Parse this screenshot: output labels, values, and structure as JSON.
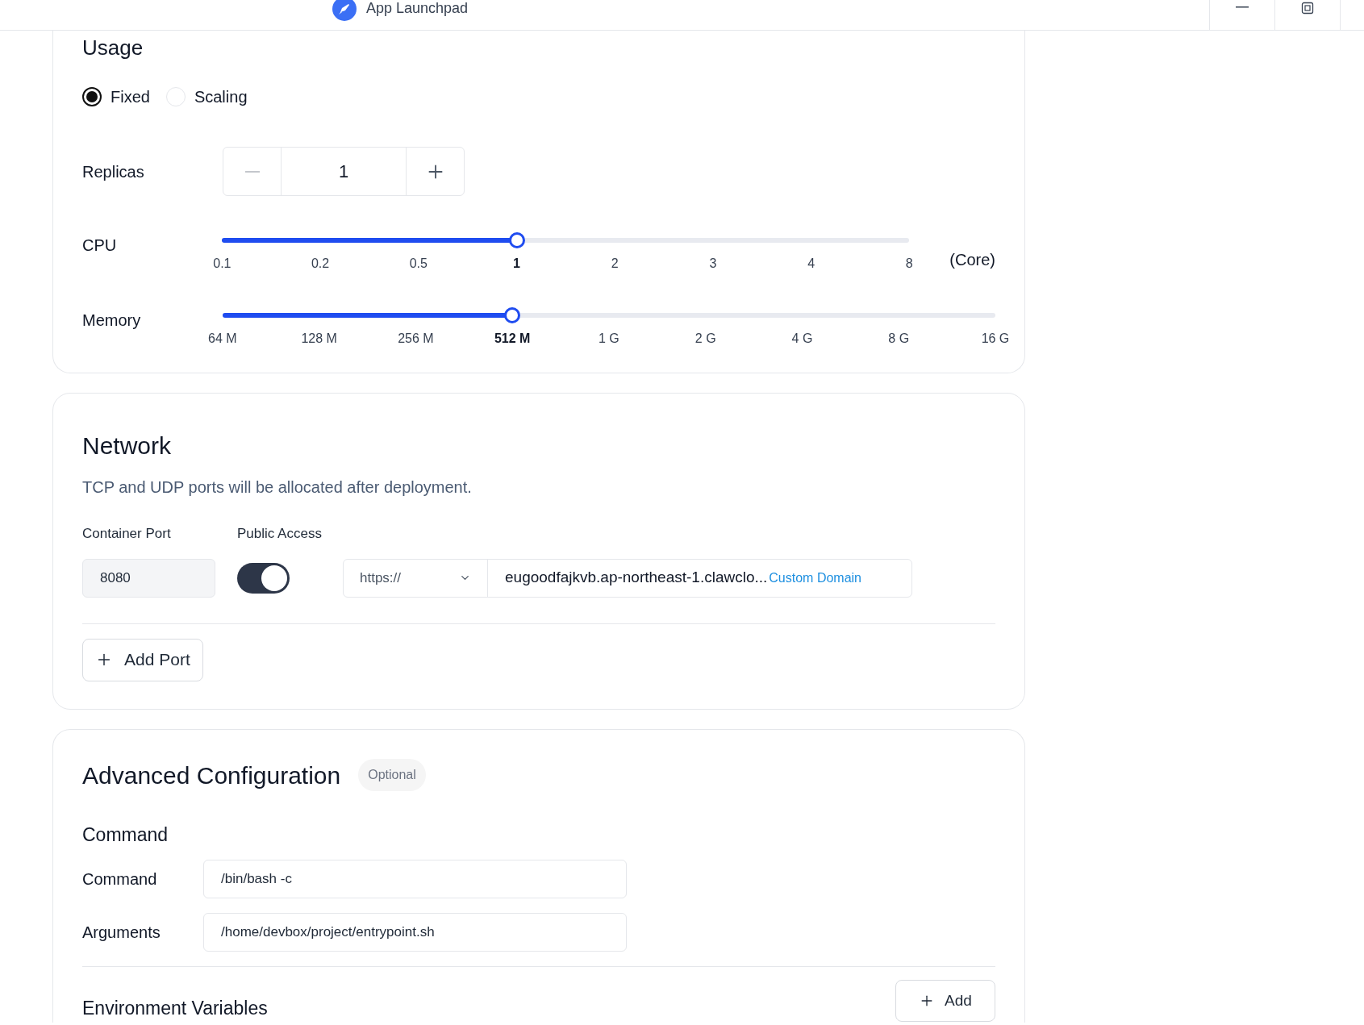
{
  "window": {
    "title": "App Launchpad"
  },
  "usage": {
    "title": "Usage",
    "modes": [
      {
        "label": "Fixed",
        "selected": true
      },
      {
        "label": "Scaling",
        "selected": false
      }
    ],
    "replicas": {
      "label": "Replicas",
      "value": "1"
    },
    "sliders": [
      {
        "label": "CPU",
        "level": 0.4286,
        "unit": "(Core)",
        "ticks": [
          {
            "label": "0.1",
            "selected": false
          },
          {
            "label": "0.2",
            "selected": false
          },
          {
            "label": "0.5",
            "selected": false
          },
          {
            "label": "1",
            "selected": true
          },
          {
            "label": "2",
            "selected": false
          },
          {
            "label": "3",
            "selected": false
          },
          {
            "label": "4",
            "selected": false
          },
          {
            "label": "8",
            "selected": false
          }
        ]
      },
      {
        "label": "Memory",
        "level": 0.375,
        "ticks": [
          {
            "label": "64 M",
            "selected": false
          },
          {
            "label": "128 M",
            "selected": false
          },
          {
            "label": "256 M",
            "selected": false
          },
          {
            "label": "512 M",
            "selected": true
          },
          {
            "label": "1 G",
            "selected": false
          },
          {
            "label": "2 G",
            "selected": false
          },
          {
            "label": "4 G",
            "selected": false
          },
          {
            "label": "8 G",
            "selected": false
          },
          {
            "label": "16 G",
            "selected": false
          }
        ]
      }
    ]
  },
  "network": {
    "title": "Network",
    "description": "TCP and UDP ports will be allocated after deployment.",
    "ports": [
      {
        "port_label": "Container Port",
        "access_label": "Public Access",
        "port": "8080",
        "public_access": true,
        "protocol": "https://",
        "domain": "eugoodfajkvb.ap-northeast-1.clawclo...",
        "custom_domain": "Custom Domain"
      }
    ],
    "add_port": "Add Port"
  },
  "advanced": {
    "title": "Advanced Configuration",
    "badge": "Optional",
    "command_heading": "Command",
    "fields": [
      {
        "label": "Command",
        "value": "/bin/bash -c"
      },
      {
        "label": "Arguments",
        "value": "/home/devbox/project/entrypoint.sh"
      }
    ],
    "env_heading": "Environment Variables",
    "add": "Add"
  }
}
